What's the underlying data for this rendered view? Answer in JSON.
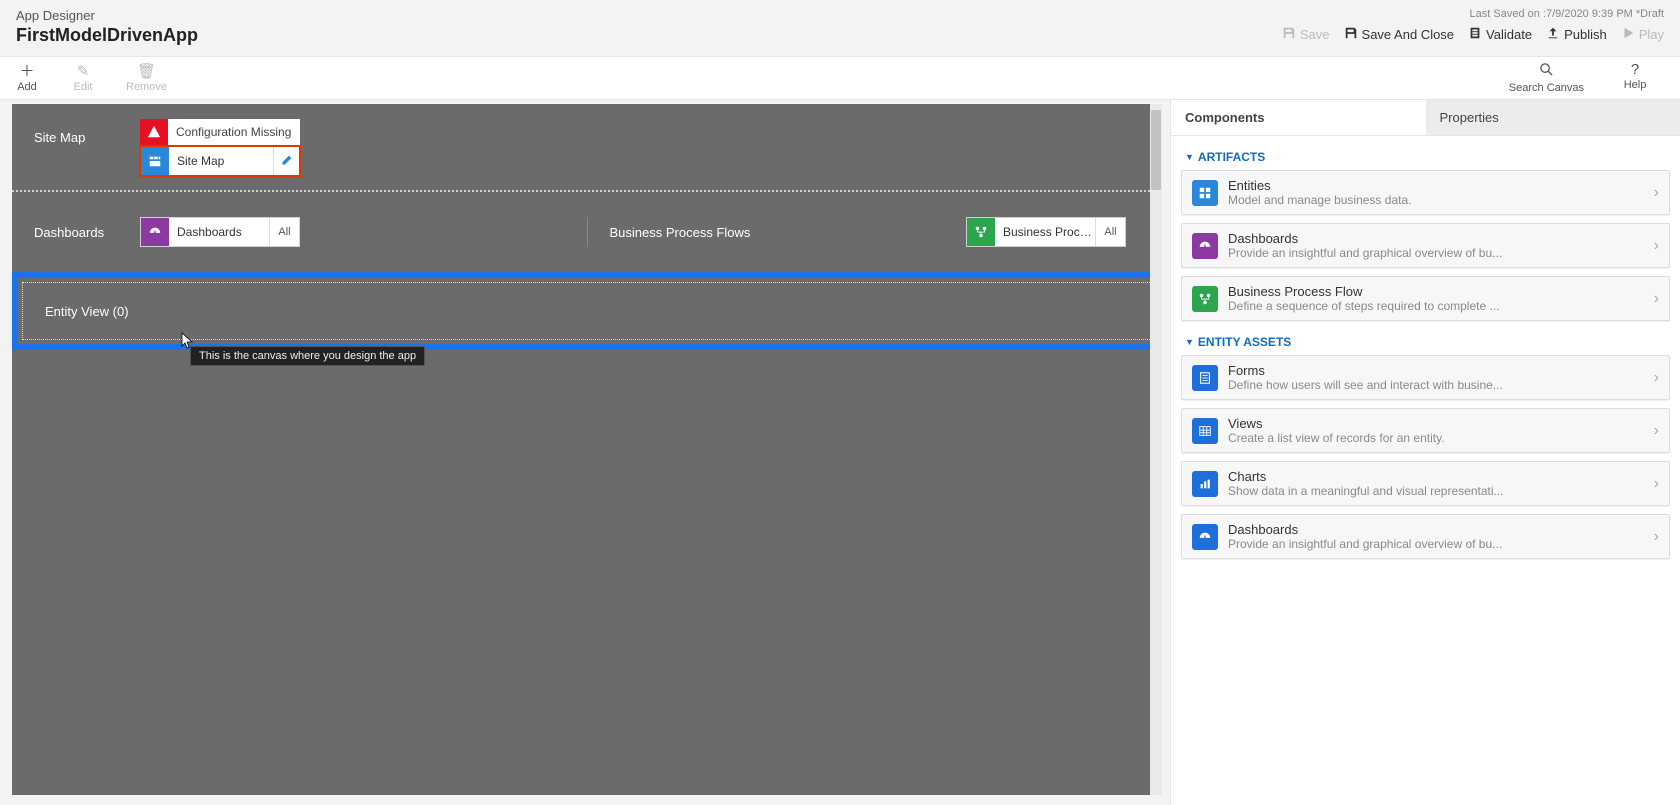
{
  "header": {
    "designer_label": "App Designer",
    "app_name": "FirstModelDrivenApp",
    "last_saved": "Last Saved on :7/9/2020 9:39 PM *Draft",
    "save": "Save",
    "save_and_close": "Save And Close",
    "validate": "Validate",
    "publish": "Publish",
    "play": "Play"
  },
  "toolbar": {
    "add": "Add",
    "edit": "Edit",
    "remove": "Remove",
    "search": "Search Canvas",
    "help": "Help"
  },
  "canvas": {
    "site_map_label": "Site Map",
    "config_missing": "Configuration Missing",
    "site_map_tile": "Site Map",
    "dashboards_label": "Dashboards",
    "dashboards_tile": "Dashboards",
    "dashboards_scope": "All",
    "bpf_label": "Business Process Flows",
    "bpf_tile": "Business Proces...",
    "bpf_scope": "All",
    "entity_view_label": "Entity View (0)",
    "tooltip": "This is the canvas where you design the app"
  },
  "sidepanel": {
    "tab_components": "Components",
    "tab_properties": "Properties",
    "sections": {
      "artifacts": "ARTIFACTS",
      "entity_assets": "ENTITY ASSETS"
    },
    "artifacts": [
      {
        "title": "Entities",
        "desc": "Model and manage business data.",
        "color": "#2b88d8",
        "icon": "grid"
      },
      {
        "title": "Dashboards",
        "desc": "Provide an insightful and graphical overview of bu...",
        "color": "#8b3aa1",
        "icon": "gauge"
      },
      {
        "title": "Business Process Flow",
        "desc": "Define a sequence of steps required to complete ...",
        "color": "#2da44e",
        "icon": "flow"
      }
    ],
    "entity_assets": [
      {
        "title": "Forms",
        "desc": "Define how users will see and interact with busine...",
        "color": "#1e6fd9",
        "icon": "form"
      },
      {
        "title": "Views",
        "desc": "Create a list view of records for an entity.",
        "color": "#1e6fd9",
        "icon": "table"
      },
      {
        "title": "Charts",
        "desc": "Show data in a meaningful and visual representati...",
        "color": "#1e6fd9",
        "icon": "chart"
      },
      {
        "title": "Dashboards",
        "desc": "Provide an insightful and graphical overview of bu...",
        "color": "#1e6fd9",
        "icon": "gauge"
      }
    ]
  }
}
